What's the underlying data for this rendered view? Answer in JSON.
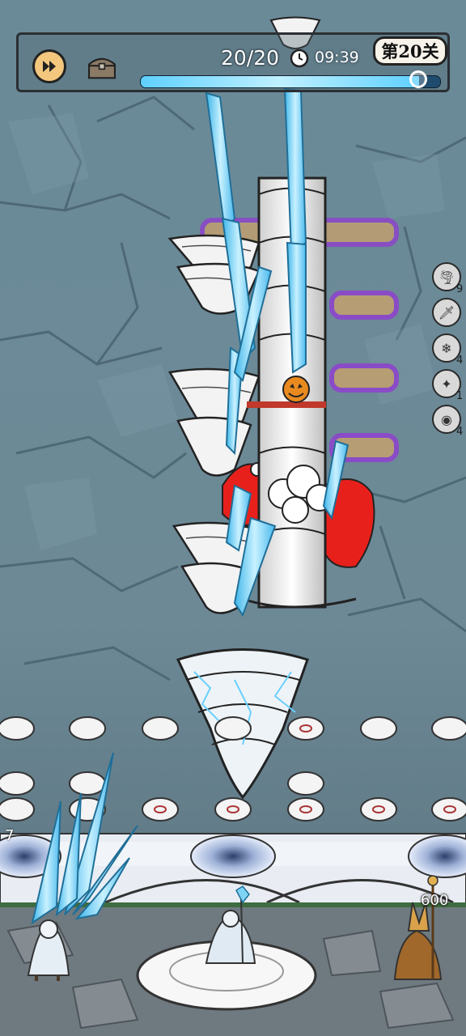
{
  "hud": {
    "wave": "20/20",
    "time": "09:39",
    "level": "第20关",
    "wave_progress": 0.93
  },
  "icons": {
    "speed": "fast-forward-icon",
    "chest": "treasure-chest-icon",
    "clock": "clock-icon"
  },
  "skills": [
    {
      "name": "tornado-skill-icon",
      "count": "9"
    },
    {
      "name": "dagger-skill-icon",
      "count": ""
    },
    {
      "name": "ice-pillar-skill-icon",
      "count": "4"
    },
    {
      "name": "shard-skill-icon",
      "count": "1"
    },
    {
      "name": "vortex-skill-icon",
      "count": "4"
    }
  ],
  "left_counter": "7",
  "boss": {
    "hp_text": "600"
  },
  "colors": {
    "hud_border": "#2b2f33",
    "speed_button": "#f3c77d",
    "ice": "#7fd4f5",
    "enemy_red": "#e8201b",
    "purple_glow": "#8a4cc6"
  }
}
